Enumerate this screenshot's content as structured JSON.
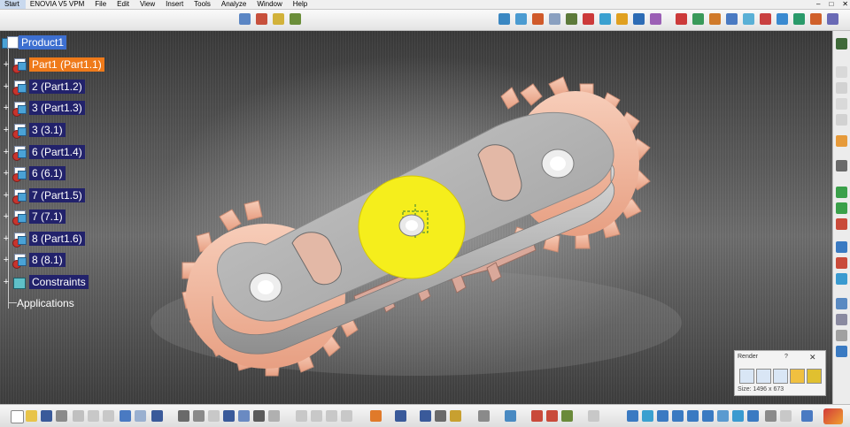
{
  "menu": {
    "items": [
      "Start",
      "ENOVIA V5 VPM",
      "File",
      "Edit",
      "View",
      "Insert",
      "Tools",
      "Analyze",
      "Window",
      "Help"
    ],
    "window_controls": [
      "–",
      "□",
      "✕"
    ]
  },
  "tree": {
    "root": "Product1",
    "nodes": [
      {
        "label": "Part1 (Part1.1)",
        "selected": true
      },
      {
        "label": "2 (Part1.2)"
      },
      {
        "label": "3 (Part1.3)"
      },
      {
        "label": "3 (3.1)"
      },
      {
        "label": "6 (Part1.4)"
      },
      {
        "label": "6 (6.1)"
      },
      {
        "label": "7 (Part1.5)"
      },
      {
        "label": "7 (7.1)"
      },
      {
        "label": "8 (Part1.6)"
      },
      {
        "label": "8 (8.1)"
      },
      {
        "label": "Constraints"
      }
    ],
    "applications": "Applications"
  },
  "render_dialog": {
    "title": "Render",
    "help": "?",
    "close": "✕",
    "size": "Size: 1496 x 673"
  },
  "colors": {
    "gear": "#f2b9a1",
    "plate": "#b9b9b9",
    "highlight": "#f5ee1c",
    "selection": "#ef7a1a",
    "tree_label_bg": "#22226b"
  }
}
